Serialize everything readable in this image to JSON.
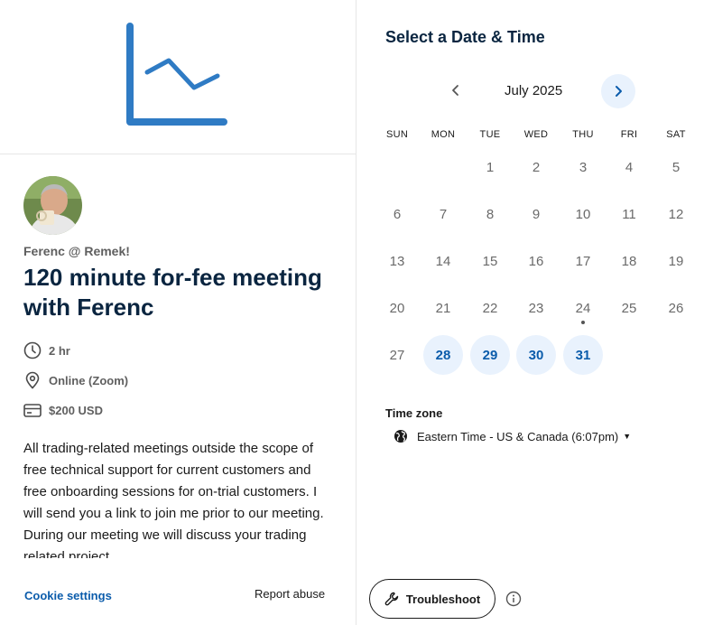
{
  "left": {
    "host": "Ferenc @ Remek!",
    "title": "120 minute for-fee meeting with Ferenc",
    "details": {
      "duration": "2 hr",
      "location": "Online (Zoom)",
      "price": "$200 USD"
    },
    "description": "All trading-related meetings outside the scope of free technical support for current customers and free onboarding sessions for on-trial customers. I will send you a link to join me prior to our meeting. During our meeting we will discuss your trading related project",
    "cookie_settings": "Cookie settings",
    "report_abuse": "Report abuse"
  },
  "right": {
    "title": "Select a Date & Time",
    "month": "July 2025",
    "weekdays": [
      "SUN",
      "MON",
      "TUE",
      "WED",
      "THU",
      "FRI",
      "SAT"
    ],
    "days": {
      "d1": "1",
      "d2": "2",
      "d3": "3",
      "d4": "4",
      "d5": "5",
      "d6": "6",
      "d7": "7",
      "d8": "8",
      "d9": "9",
      "d10": "10",
      "d11": "11",
      "d12": "12",
      "d13": "13",
      "d14": "14",
      "d15": "15",
      "d16": "16",
      "d17": "17",
      "d18": "18",
      "d19": "19",
      "d20": "20",
      "d21": "21",
      "d22": "22",
      "d23": "23",
      "d24": "24",
      "d25": "25",
      "d26": "26",
      "d27": "27",
      "d28": "28",
      "d29": "29",
      "d30": "30",
      "d31": "31"
    },
    "available_days": [
      "28",
      "29",
      "30",
      "31"
    ],
    "today": "24",
    "timezone_label": "Time zone",
    "timezone_value": "Eastern Time - US & Canada (6:07pm)",
    "troubleshoot": "Troubleshoot"
  },
  "colors": {
    "accent": "#0b5cab",
    "available_bg": "#e9f2fd",
    "logo_blue": "#2f7bc4",
    "heading": "#0a2540"
  },
  "icons": [
    "chart-logo-icon",
    "clock-icon",
    "location-pin-icon",
    "credit-card-icon",
    "chevron-left-icon",
    "chevron-right-icon",
    "globe-icon",
    "caret-down-icon",
    "wrench-icon",
    "info-icon"
  ]
}
